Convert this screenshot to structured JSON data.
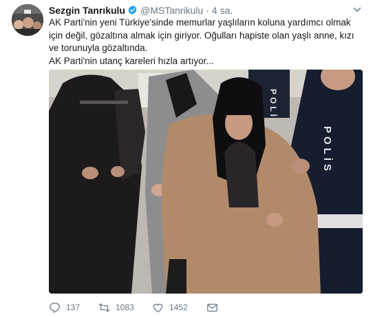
{
  "tweet": {
    "author_name": "Sezgin Tanrıkulu",
    "handle": "@MSTanrikulu",
    "separator": "·",
    "time": "4 sa.",
    "text_line1": "AK Parti'nin yeni Türkiye'sinde memurlar yaşlıların koluna yardımcı olmak için değil, gözaltına almak için giriyor. Oğulları hapiste olan yaşlı anne, kızı ve torunuyla gözaltında.",
    "text_line2": "AK Parti'nin utanç kareleri hızla artıyor...",
    "photo_text_left": "POLİ",
    "photo_text_right": "POLİS"
  },
  "actions": {
    "replies": "137",
    "retweets": "1083",
    "likes": "1452"
  },
  "icons": {
    "verified": "verified-badge-icon",
    "caret": "chevron-down-icon",
    "reply": "reply-icon",
    "retweet": "retweet-icon",
    "like": "heart-icon",
    "dm": "envelope-icon"
  },
  "colors": {
    "verified": "#1da1f2",
    "meta": "#657786",
    "text": "#14171a"
  }
}
